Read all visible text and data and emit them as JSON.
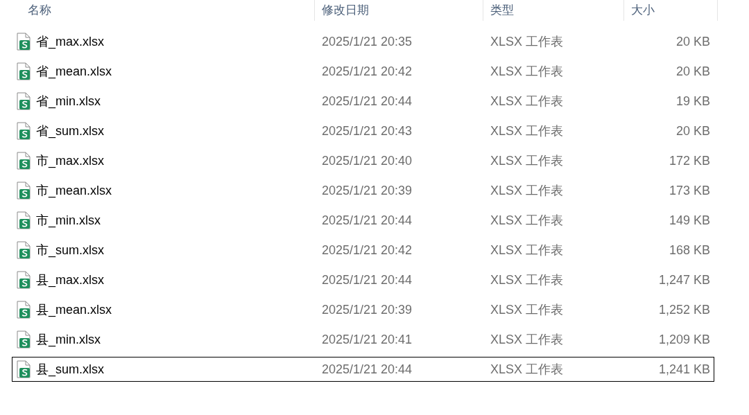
{
  "columns": [
    "名称",
    "修改日期",
    "类型",
    "大小"
  ],
  "files": [
    {
      "name": "省_max.xlsx",
      "modified": "2025/1/21 20:35",
      "type": "XLSX 工作表",
      "size": "20 KB",
      "focused": false
    },
    {
      "name": "省_mean.xlsx",
      "modified": "2025/1/21 20:42",
      "type": "XLSX 工作表",
      "size": "20 KB",
      "focused": false
    },
    {
      "name": "省_min.xlsx",
      "modified": "2025/1/21 20:44",
      "type": "XLSX 工作表",
      "size": "19 KB",
      "focused": false
    },
    {
      "name": "省_sum.xlsx",
      "modified": "2025/1/21 20:43",
      "type": "XLSX 工作表",
      "size": "20 KB",
      "focused": false
    },
    {
      "name": "市_max.xlsx",
      "modified": "2025/1/21 20:40",
      "type": "XLSX 工作表",
      "size": "172 KB",
      "focused": false
    },
    {
      "name": "市_mean.xlsx",
      "modified": "2025/1/21 20:39",
      "type": "XLSX 工作表",
      "size": "173 KB",
      "focused": false
    },
    {
      "name": "市_min.xlsx",
      "modified": "2025/1/21 20:44",
      "type": "XLSX 工作表",
      "size": "149 KB",
      "focused": false
    },
    {
      "name": "市_sum.xlsx",
      "modified": "2025/1/21 20:42",
      "type": "XLSX 工作表",
      "size": "168 KB",
      "focused": false
    },
    {
      "name": "县_max.xlsx",
      "modified": "2025/1/21 20:44",
      "type": "XLSX 工作表",
      "size": "1,247 KB",
      "focused": false
    },
    {
      "name": "县_mean.xlsx",
      "modified": "2025/1/21 20:39",
      "type": "XLSX 工作表",
      "size": "1,252 KB",
      "focused": false
    },
    {
      "name": "县_min.xlsx",
      "modified": "2025/1/21 20:41",
      "type": "XLSX 工作表",
      "size": "1,209 KB",
      "focused": false
    },
    {
      "name": "县_sum.xlsx",
      "modified": "2025/1/21 20:44",
      "type": "XLSX 工作表",
      "size": "1,241 KB",
      "focused": true
    }
  ]
}
